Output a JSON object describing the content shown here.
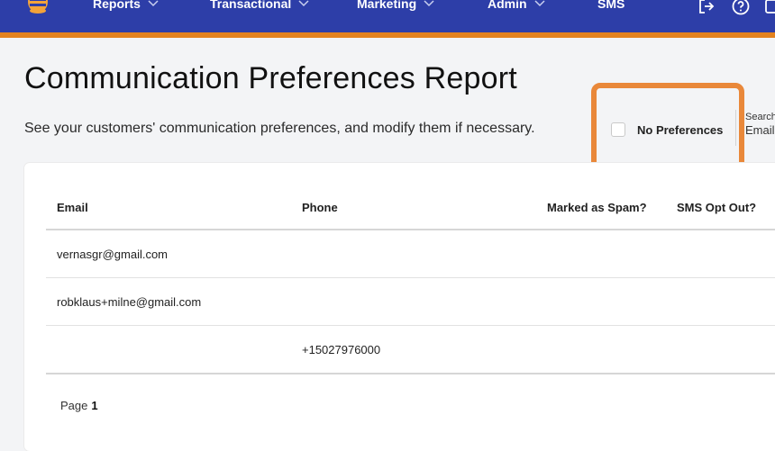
{
  "nav": {
    "items": [
      {
        "label": "Reports",
        "has_dropdown": true
      },
      {
        "label": "Transactional",
        "has_dropdown": true
      },
      {
        "label": "Marketing",
        "has_dropdown": true
      },
      {
        "label": "Admin",
        "has_dropdown": true
      },
      {
        "label": "SMS",
        "has_dropdown": false
      }
    ],
    "icons": [
      "logout-icon",
      "help-icon",
      "profile-icon"
    ],
    "colors": {
      "bar": "#2d3ea8",
      "stripe": "#e3821f"
    }
  },
  "page": {
    "title": "Communication Preferences Report",
    "subtitle": "See your customers' communication preferences, and modify them if necessary."
  },
  "filters": {
    "no_preferences_label": "No Preferences",
    "no_preferences_checked": false,
    "search_label": "Search",
    "search_field": "Email"
  },
  "table": {
    "headers": [
      "Email",
      "Phone",
      "Marked as Spam?",
      "SMS Opt Out?"
    ],
    "rows": [
      {
        "email": "vernasgr@gmail.com",
        "phone": ""
      },
      {
        "email": "robklaus+milne@gmail.com",
        "phone": ""
      },
      {
        "email": "",
        "phone": "+15027976000"
      }
    ]
  },
  "pagination": {
    "label": "Page",
    "current": "1"
  }
}
